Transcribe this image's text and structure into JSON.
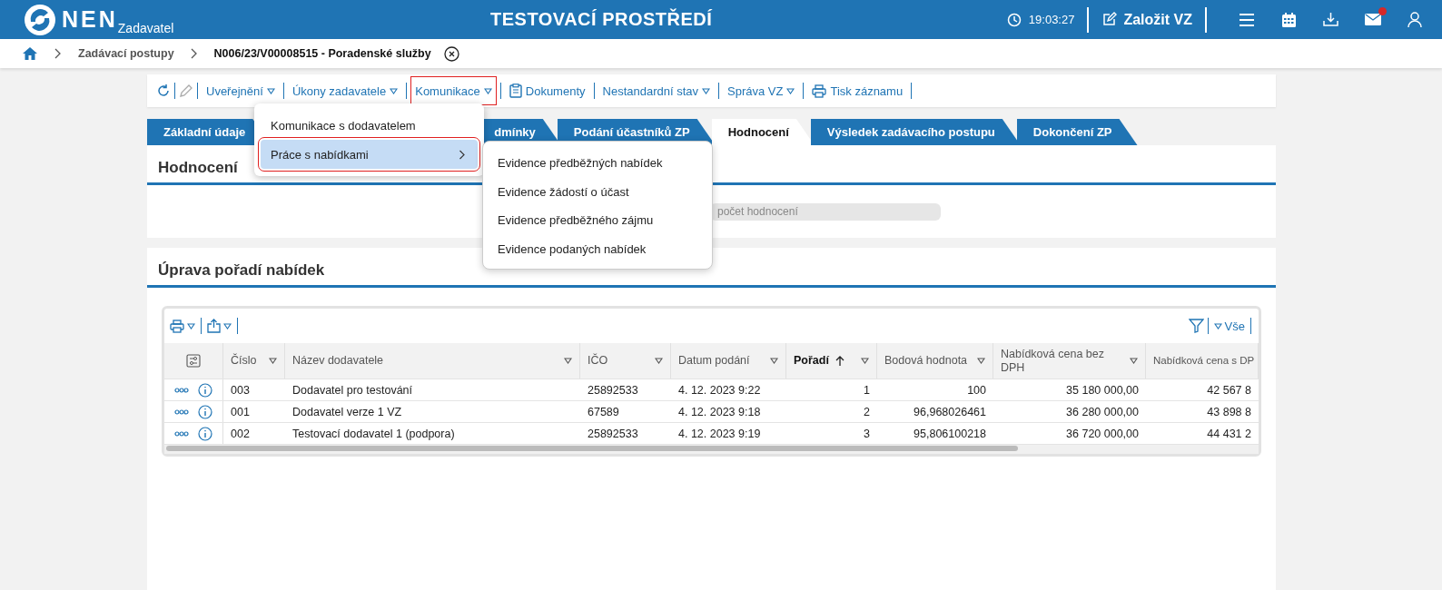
{
  "header": {
    "logo": "NEN",
    "logo_sub": "Zadavatel",
    "title": "TESTOVACÍ PROSTŘEDÍ",
    "time": "19:03:27",
    "create_button": "Založit VZ",
    "mail_unread": true
  },
  "breadcrumb": [
    "Zadávací postupy",
    "N006/23/V00008515 - Poradenské služby"
  ],
  "toolbar": [
    {
      "label": "Uveřejnění",
      "kind": "dropdown",
      "highlighted": false
    },
    {
      "label": "Úkony zadavatele",
      "kind": "dropdown",
      "highlighted": false
    },
    {
      "label": "Komunikace",
      "kind": "dropdown",
      "highlighted": true
    },
    {
      "label": "Dokumenty",
      "kind": "document",
      "highlighted": false
    },
    {
      "label": "Nestandardní stav",
      "kind": "dropdown",
      "highlighted": false
    },
    {
      "label": "Správa VZ",
      "kind": "dropdown",
      "highlighted": false
    },
    {
      "label": "Tisk záznamu",
      "kind": "print",
      "highlighted": false
    }
  ],
  "tabs": [
    {
      "label": "Základní údaje",
      "selected": false
    },
    {
      "label": "dmínky",
      "selected": false
    },
    {
      "label": "Podání účastníků ZP",
      "selected": false
    },
    {
      "label": "Hodnocení",
      "selected": true
    },
    {
      "label": "Výsledek zadávacího postupu",
      "selected": false
    },
    {
      "label": "Dokončení ZP",
      "selected": false
    }
  ],
  "evaluation_panel": {
    "title": "Hodnocení",
    "button": "počet hodnocení"
  },
  "ranking_panel": {
    "title": "Úprava pořadí nabídek",
    "filter_label": "Vše",
    "columns": [
      {
        "label": "Číslo",
        "numeric": false,
        "sorted": false
      },
      {
        "label": "Název dodavatele",
        "numeric": false,
        "sorted": false
      },
      {
        "label": "IČO",
        "numeric": false,
        "sorted": false
      },
      {
        "label": "Datum podání",
        "numeric": false,
        "sorted": false
      },
      {
        "label": "Pořadí",
        "numeric": true,
        "sorted": true
      },
      {
        "label": "Bodová hodnota",
        "numeric": true,
        "sorted": false
      },
      {
        "label": "Nabídková cena bez DPH",
        "numeric": true,
        "sorted": false
      },
      {
        "label": "Nabídková cena s DP",
        "numeric": true,
        "sorted": false
      }
    ],
    "rows": [
      [
        "003",
        "Dodavatel pro testování",
        "25892533",
        "4. 12. 2023 9:22",
        "1",
        "100",
        "35 180 000,00",
        "42 567 8"
      ],
      [
        "001",
        "Dodavatel verze 1 VZ",
        "67589",
        "4. 12. 2023 9:18",
        "2",
        "96,968026461",
        "36 280 000,00",
        "43 898 8"
      ],
      [
        "002",
        "Testovací dodavatel 1 (podpora)",
        "25892533",
        "4. 12. 2023 9:19",
        "3",
        "95,806100218",
        "36 720 000,00",
        "44 431 2"
      ]
    ]
  },
  "menu": {
    "items": [
      {
        "label": "Komunikace s dodavatelem",
        "selected": false,
        "highlighted": false,
        "submenu": false
      },
      {
        "label": "Práce s nabídkami",
        "selected": true,
        "highlighted": true,
        "submenu": true
      }
    ],
    "submenu": [
      "Evidence předběžných nabídek",
      "Evidence žádostí o účast",
      "Evidence předběžného zájmu",
      "Evidence podaných nabídek"
    ]
  }
}
